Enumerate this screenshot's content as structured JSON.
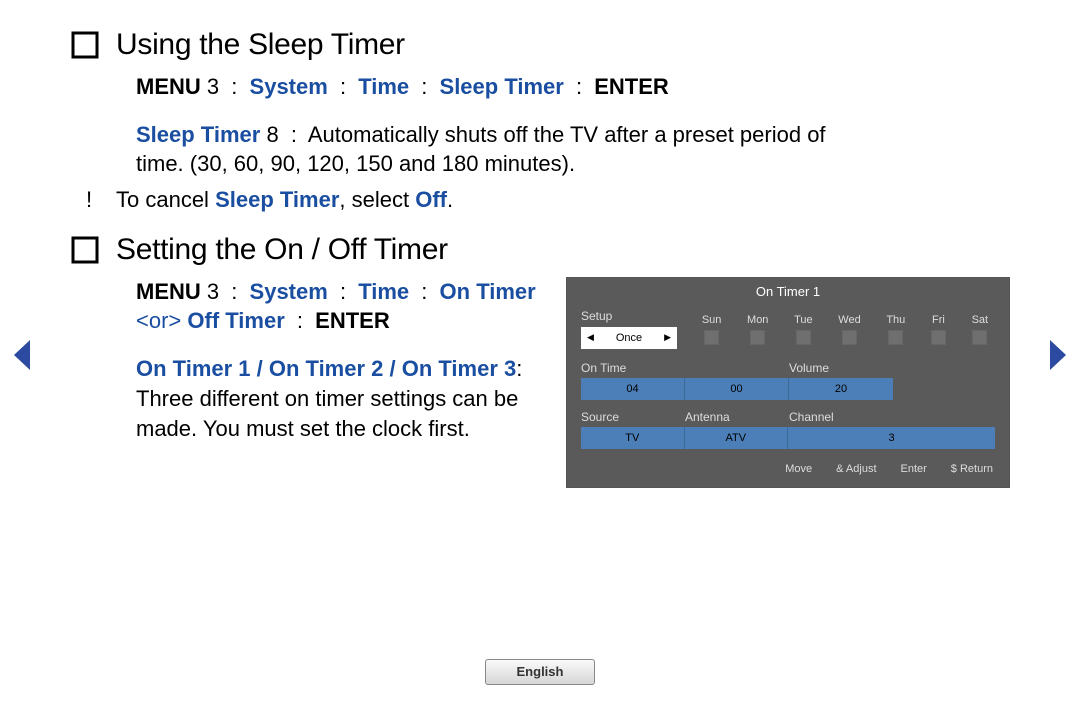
{
  "section1": {
    "heading": "Using the Sleep Timer",
    "nav": {
      "menu": "MENU",
      "menu_suffix": "3",
      "arrow": ":",
      "p1": "System",
      "p2": "Time",
      "p3": "Sleep Timer",
      "enter": "ENTER"
    },
    "para": {
      "term": "Sleep Timer",
      "term_suffix": "8",
      "sep": ":",
      "body1": "Automatically shuts off the TV after a preset period of",
      "body2": "time. (30, 60, 90, 120, 150 and 180 minutes)."
    },
    "note": {
      "mark": "!",
      "t1": "To cancel ",
      "t2": "Sleep Timer",
      "t3": ", select ",
      "t4": "Off",
      "t5": "."
    }
  },
  "section2": {
    "heading": "Setting the On / Off Timer",
    "nav": {
      "menu": "MENU",
      "menu_suffix": "3",
      "arrow": ":",
      "p1": "System",
      "p2": "Time",
      "p3a": "On",
      "p3b": "Timer",
      "or_open": " <or> ",
      "p4": "Off Timer",
      "enter": "ENTER"
    },
    "para": {
      "term": "On Timer 1 / On Timer 2 / On Timer",
      "term2": "3",
      "sep": ":",
      "body": "Three different on timer settings can be made. You must set the clock first."
    }
  },
  "panel": {
    "title": "On Timer 1",
    "setup_label": "Setup",
    "once": "Once",
    "days": [
      "Sun",
      "Mon",
      "Tue",
      "Wed",
      "Thu",
      "Fri",
      "Sat"
    ],
    "on_time_label": "On Time",
    "volume_label": "Volume",
    "hour": "04",
    "minute": "00",
    "volume": "20",
    "source_label": "Source",
    "antenna_label": "Antenna",
    "channel_label": "Channel",
    "source": "TV",
    "antenna": "ATV",
    "channel": "3",
    "foot1": "Move",
    "foot2": "& Adjust",
    "foot3": "Enter",
    "foot4": "$ Return"
  },
  "language": "English"
}
